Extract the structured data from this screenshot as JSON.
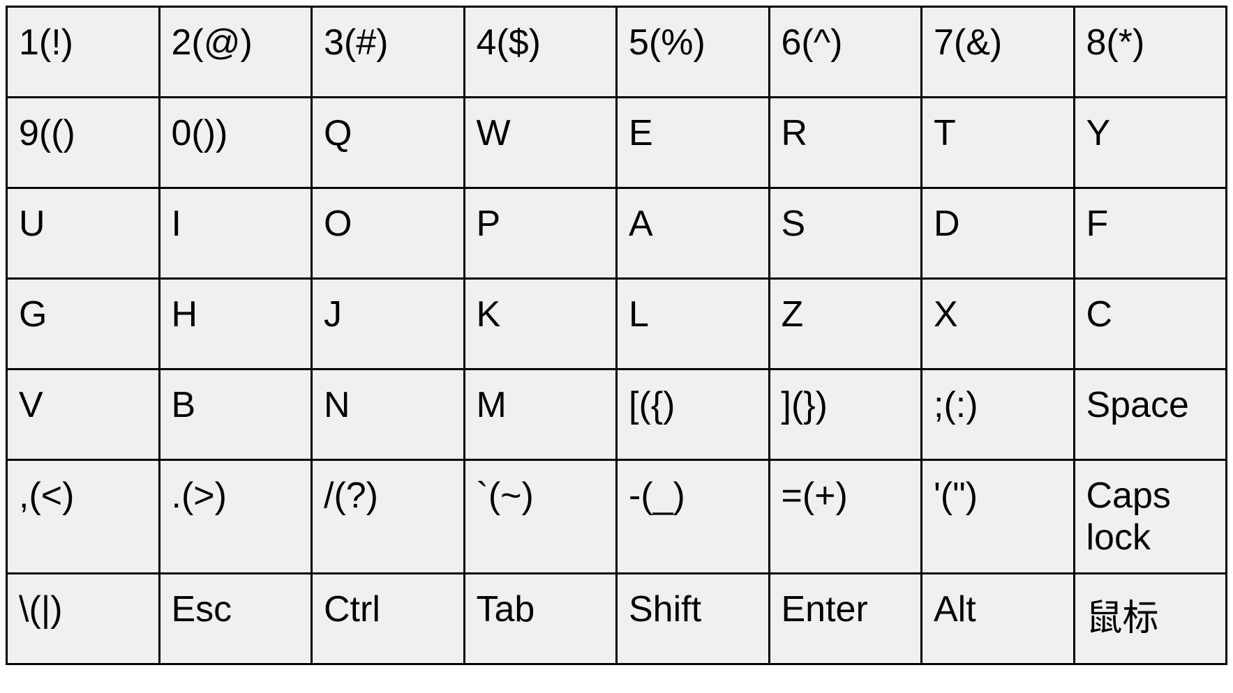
{
  "keyboard": {
    "rows": [
      [
        "1(!)",
        "2(@)",
        "3(#)",
        "4($)",
        "5(%)",
        "6(^)",
        "7(&)",
        "8(*)"
      ],
      [
        "9(()",
        "0())",
        "Q",
        "W",
        "E",
        "R",
        "T",
        "Y"
      ],
      [
        "U",
        "I",
        "O",
        "P",
        "A",
        "S",
        "D",
        "F"
      ],
      [
        "G",
        "H",
        "J",
        "K",
        "L",
        "Z",
        "X",
        "C"
      ],
      [
        "V",
        "B",
        "N",
        "M",
        "[({)",
        "](})",
        ";(:)",
        "Space"
      ],
      [
        ",(<)",
        ".(>)",
        "/(?)",
        "`(~)",
        "-(_)",
        "=(+)",
        "'(\")",
        "Caps lock"
      ],
      [
        "\\(|)",
        "Esc",
        "Ctrl",
        "Tab",
        "Shift",
        "Enter",
        "Alt",
        "鼠标"
      ]
    ]
  }
}
